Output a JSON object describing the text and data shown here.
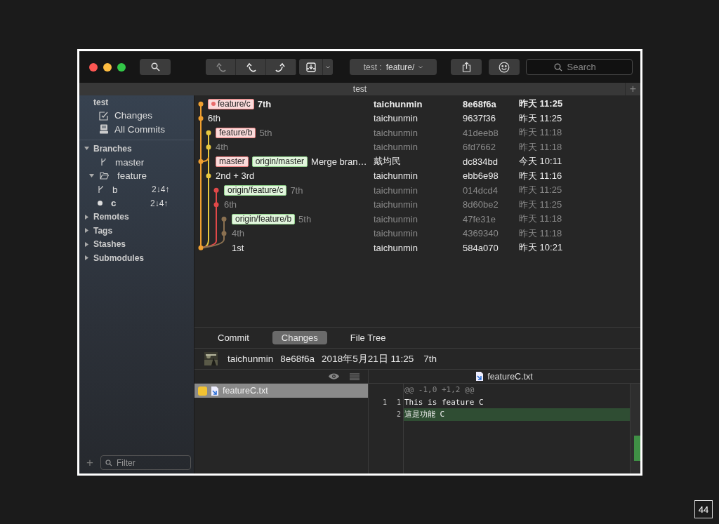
{
  "toolbar": {
    "repo_selector": {
      "repo": "test :",
      "branch": "feature/"
    },
    "search": {
      "placeholder": "Search"
    }
  },
  "tab_bar": {
    "title": "test",
    "add_label": "+"
  },
  "sidebar": {
    "repo": "test",
    "views": [
      {
        "label": "Changes",
        "kind": "changes"
      },
      {
        "label": "All Commits",
        "kind": "commits"
      }
    ],
    "sections": [
      {
        "label": "Branches",
        "expanded": true,
        "children": [
          {
            "label": "master",
            "kind": "branch",
            "current": false
          },
          {
            "label": "feature",
            "kind": "folder",
            "expanded": true,
            "children": [
              {
                "label": "b",
                "kind": "branch",
                "current": false,
                "status": "2↓4↑"
              },
              {
                "label": "c",
                "kind": "branch",
                "current": true,
                "status": "2↓4↑"
              }
            ]
          }
        ]
      },
      {
        "label": "Remotes",
        "expanded": false
      },
      {
        "label": "Tags",
        "expanded": false
      },
      {
        "label": "Stashes",
        "expanded": false
      },
      {
        "label": "Submodules",
        "expanded": false
      }
    ],
    "filter": {
      "placeholder": "Filter",
      "add_label": "+"
    }
  },
  "commits": [
    {
      "refs": [
        {
          "label": "feature/c",
          "kind": "local",
          "current": true
        }
      ],
      "message": "7th",
      "author": "taichunmin",
      "hash": "8e68f6a",
      "date": "昨天 11:25",
      "bold": true,
      "dimmed": false
    },
    {
      "message": "6th",
      "author": "taichunmin",
      "hash": "9637f36",
      "date": "昨天 11:25",
      "bold": false,
      "dimmed": false
    },
    {
      "refs": [
        {
          "label": "feature/b",
          "kind": "local",
          "current": false
        }
      ],
      "message": "5th",
      "author": "taichunmin",
      "hash": "41deeb8",
      "date": "昨天 11:18",
      "bold": false,
      "dimmed": true
    },
    {
      "message": "4th",
      "author": "taichunmin",
      "hash": "6fd7662",
      "date": "昨天 11:18",
      "bold": false,
      "dimmed": true
    },
    {
      "refs": [
        {
          "label": "master",
          "kind": "local",
          "current": false
        },
        {
          "label": "origin/master",
          "kind": "remote",
          "current": false
        }
      ],
      "message": "Merge bran…",
      "author": "戴均民",
      "hash": "dc834bd",
      "date": "今天 10:11",
      "bold": false,
      "dimmed": false
    },
    {
      "message": "2nd + 3rd",
      "author": "taichunmin",
      "hash": "ebb6e98",
      "date": "昨天 11:16",
      "bold": false,
      "dimmed": false
    },
    {
      "refs": [
        {
          "label": "origin/feature/c",
          "kind": "remote",
          "current": false
        }
      ],
      "message": "7th",
      "author": "taichunmin",
      "hash": "014dcd4",
      "date": "昨天 11:25",
      "bold": false,
      "dimmed": true
    },
    {
      "message": "6th",
      "author": "taichunmin",
      "hash": "8d60be2",
      "date": "昨天 11:25",
      "bold": false,
      "dimmed": true
    },
    {
      "refs": [
        {
          "label": "origin/feature/b",
          "kind": "remote",
          "current": false
        }
      ],
      "message": "5th",
      "author": "taichunmin",
      "hash": "47fe31e",
      "date": "昨天 11:18",
      "bold": false,
      "dimmed": true
    },
    {
      "message": "4th",
      "author": "taichunmin",
      "hash": "4369340",
      "date": "昨天 11:18",
      "bold": false,
      "dimmed": true
    },
    {
      "message": "1st",
      "author": "taichunmin",
      "hash": "584a070",
      "date": "昨天 10:21",
      "bold": false,
      "dimmed": false
    }
  ],
  "detail_tabs": [
    {
      "label": "Commit",
      "selected": false
    },
    {
      "label": "Changes",
      "selected": true
    },
    {
      "label": "File Tree",
      "selected": false
    }
  ],
  "commit_info": {
    "author": "taichunmin",
    "hash": "8e68f6a",
    "date": "2018年5月21日 11:25",
    "message": "7th"
  },
  "files": [
    {
      "name": "featureC.txt",
      "selected": true
    }
  ],
  "diff": {
    "file": "featureC.txt",
    "lines": [
      {
        "kind": "hunk",
        "text": "@@ -1,0 +1,2 @@"
      },
      {
        "kind": "context",
        "old": "1",
        "new": "1",
        "text": "This is feature C"
      },
      {
        "kind": "added",
        "new": "2",
        "text": "這是功能 C"
      }
    ]
  },
  "slide_number": "44"
}
